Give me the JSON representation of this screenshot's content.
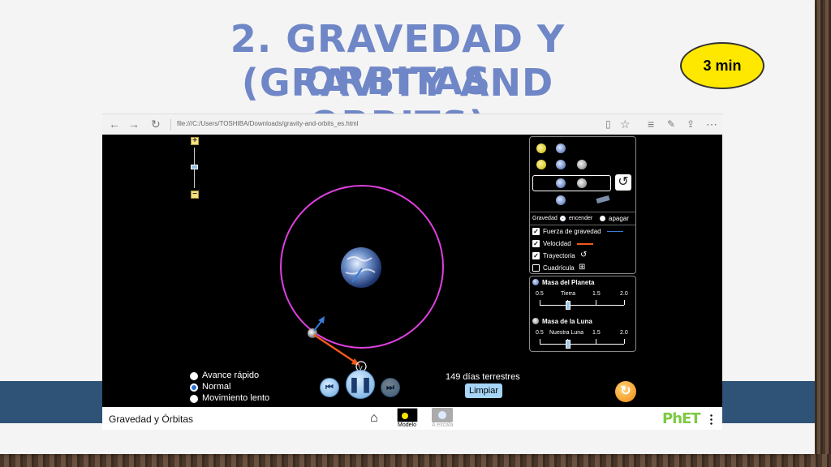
{
  "slide": {
    "title_line1": "2. GRAVEDAD Y ORBITAS",
    "title_line2": "(GRAVITY AND ORBITS)",
    "timer": "3 min",
    "colors": {
      "title": "#6f86c7",
      "timer_bg": "#ffe800",
      "band": "#2e5377"
    }
  },
  "browser": {
    "url": "file:///C:/Users/TOSHIBA/Downloads/gravity-and-orbits_es.html",
    "back_icon": "arrow-left-icon",
    "forward_icon": "arrow-right-icon",
    "refresh_icon": "refresh-icon",
    "reading_icon": "book-icon",
    "favorite_icon": "star-icon",
    "hub_icon": "lines-icon",
    "note_icon": "pen-icon",
    "share_icon": "share-icon",
    "more_icon": "ellipsis-icon"
  },
  "panel": {
    "gravity_label": "Gravedad",
    "gravity_on": "encender",
    "gravity_off": "apagar",
    "options": [
      {
        "label": "Fuerza de gravedad",
        "checked": true
      },
      {
        "label": "Velocidad",
        "checked": true
      },
      {
        "label": "Trayectoria",
        "checked": true
      },
      {
        "label": "Cuadrícula",
        "checked": false
      }
    ],
    "planet_mass": {
      "label": "Masa del Planeta",
      "ticks": [
        "0.5",
        "Tierra",
        "1.5",
        "2.0"
      ]
    },
    "moon_mass": {
      "label": "Masa de la Luna",
      "ticks": [
        "0.5",
        "Nuestra Luna",
        "1.5",
        "2.0"
      ]
    }
  },
  "playback": {
    "speeds": [
      {
        "label": "Avance rápido",
        "selected": false
      },
      {
        "label": "Normal",
        "selected": true
      },
      {
        "label": "Movimiento lento",
        "selected": false
      }
    ],
    "days": "149 días terrestres",
    "clear_button": "Limpiar"
  },
  "footer": {
    "sim_title": "Gravedad y Órbitas",
    "screens": [
      "Modelo",
      "A escala"
    ],
    "brand": "PhET"
  }
}
